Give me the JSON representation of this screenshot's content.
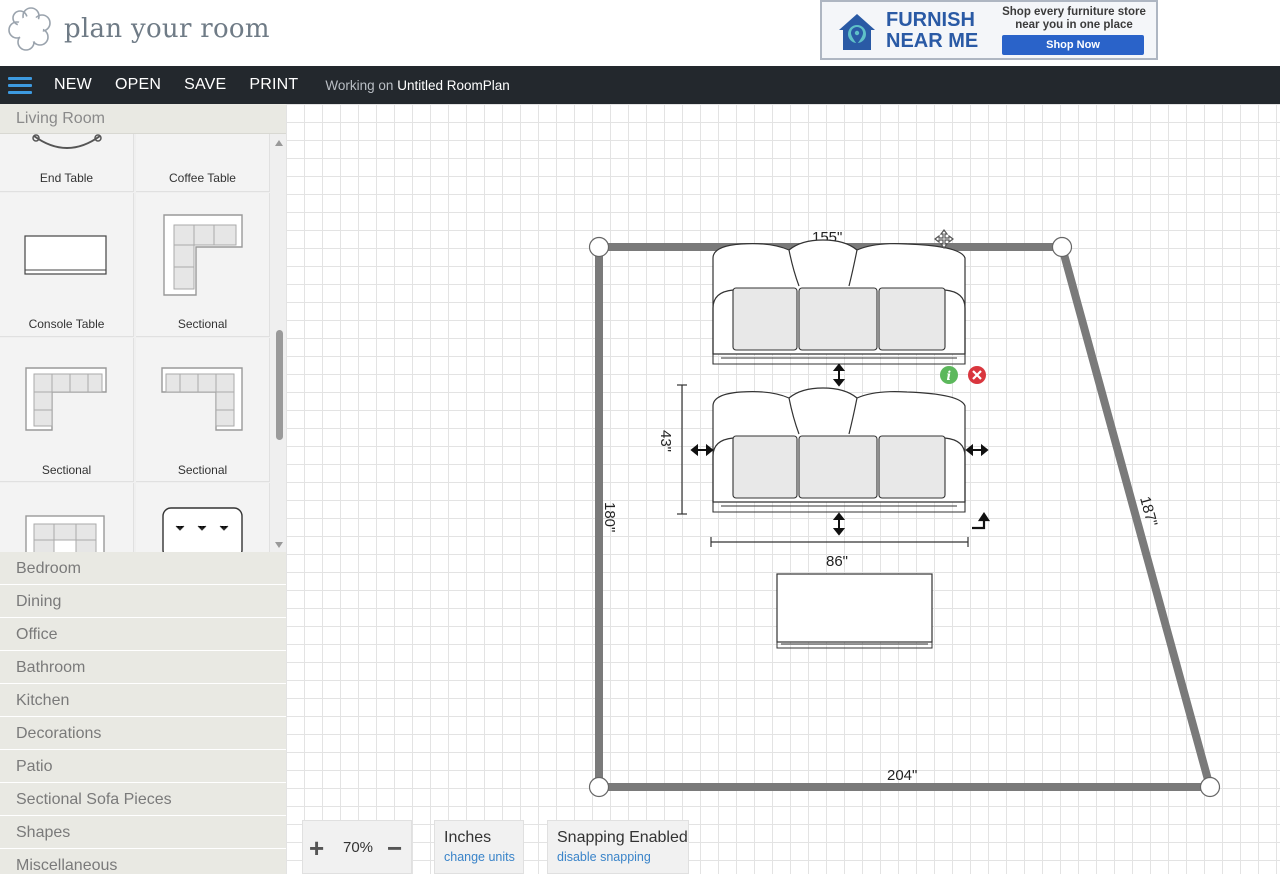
{
  "header": {
    "logo_text": "plan your room",
    "ad": {
      "brand_line1": "FURNISH",
      "brand_line2": "NEAR ME",
      "tagline": "Shop every furniture store near you in one place",
      "button": "Shop Now"
    }
  },
  "toolbar": {
    "new": "NEW",
    "open": "OPEN",
    "save": "SAVE",
    "print": "PRINT",
    "working_prefix": "Working on",
    "document_name": "Untitled RoomPlan"
  },
  "sidebar": {
    "open_category": "Living Room",
    "items": [
      "End Table",
      "Coffee Table",
      "Console Table",
      "Sectional",
      "Sectional",
      "Sectional"
    ],
    "categories": [
      "Bedroom",
      "Dining",
      "Office",
      "Bathroom",
      "Kitchen",
      "Decorations",
      "Patio",
      "Sectional Sofa Pieces",
      "Shapes",
      "Miscellaneous"
    ]
  },
  "canvas": {
    "dimensions": {
      "top": "155\"",
      "left": "180\"",
      "right": "187\"",
      "bottom": "204\"",
      "sofa_depth": "43\"",
      "sofa_width": "86\""
    }
  },
  "controls": {
    "zoom": "70%",
    "zoom_in": "+",
    "zoom_out": "−",
    "units_title": "Inches",
    "units_action": "change units",
    "snap_title": "Snapping Enabled",
    "snap_action": "disable snapping"
  },
  "colors": {
    "nav_bg": "#23282d",
    "accent": "#3d9ae0",
    "wall": "#7a7a7a",
    "ad_blue": "#2a5aa5"
  }
}
